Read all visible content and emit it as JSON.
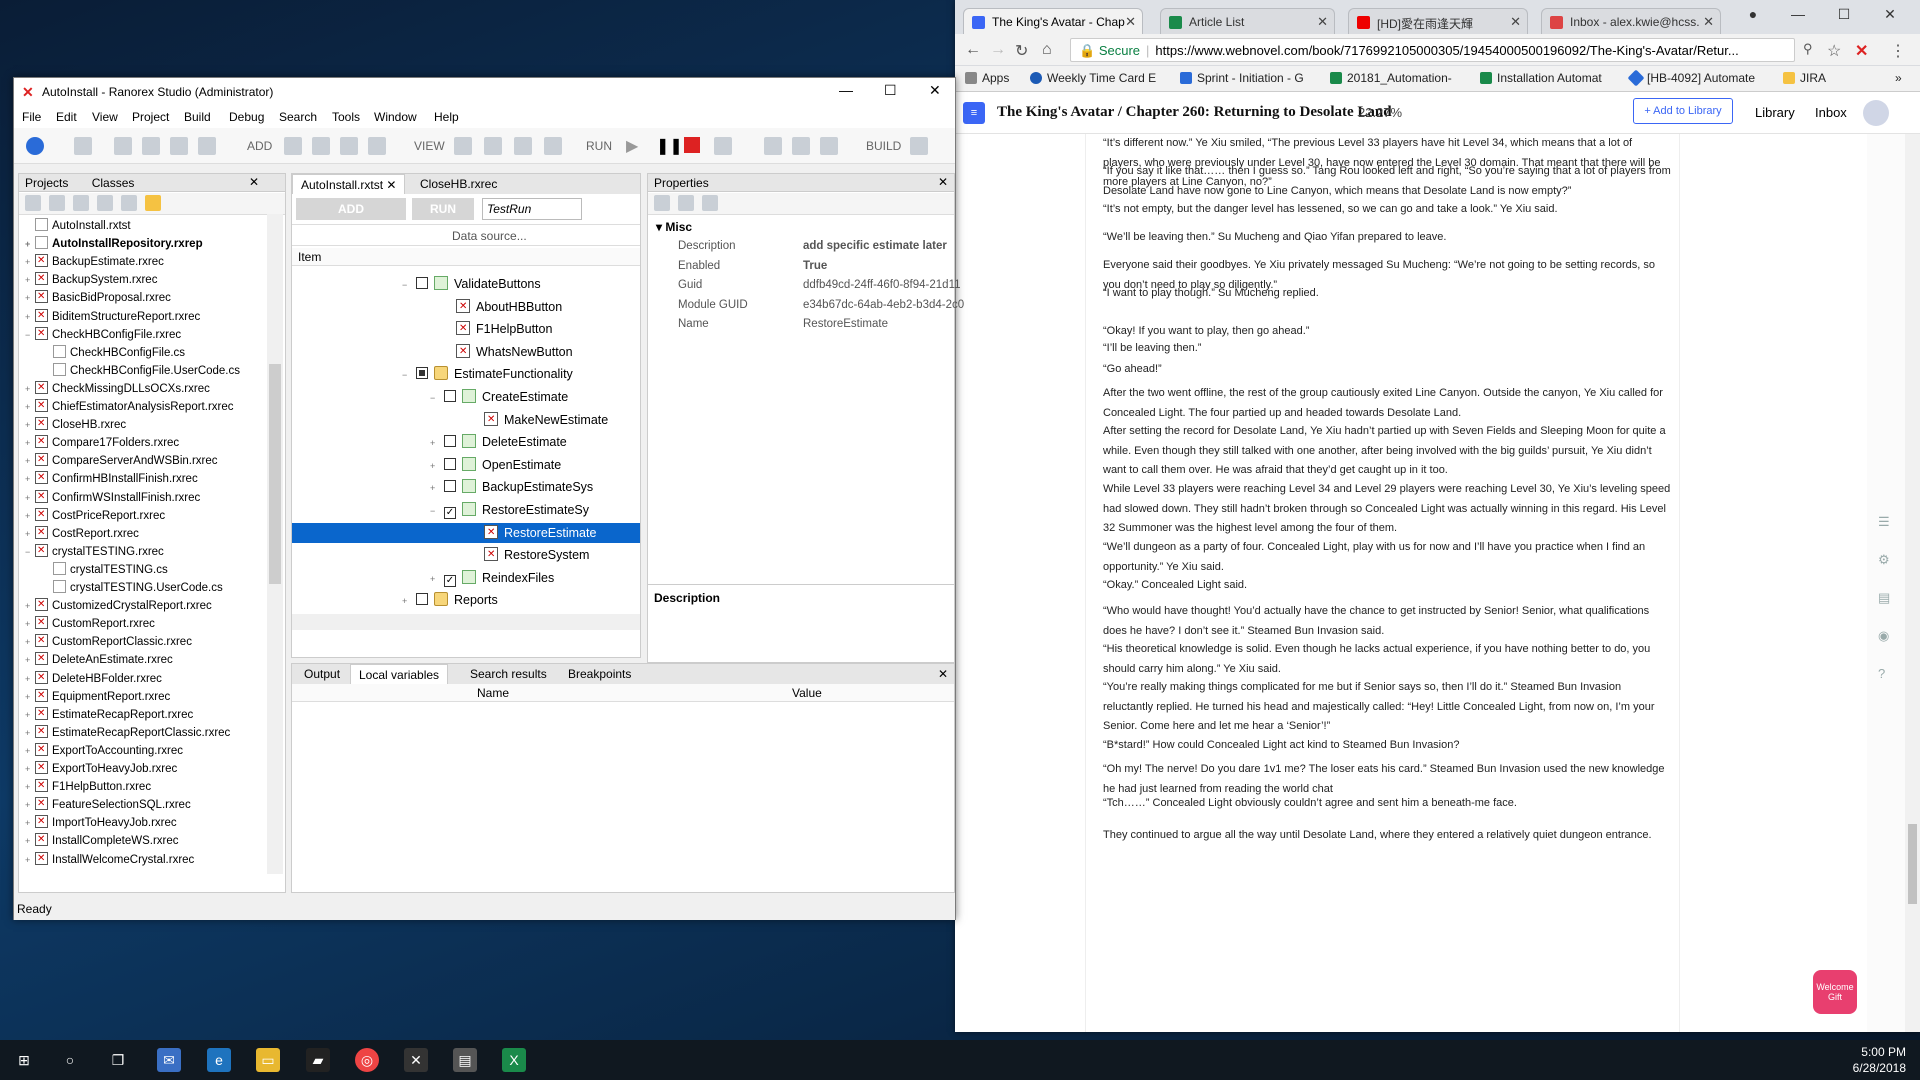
{
  "chrome": {
    "tabs": [
      {
        "label": "The King's Avatar - Chap",
        "color": "#3b66f5",
        "active": true
      },
      {
        "label": "Article List",
        "color": "#1a8a4a"
      },
      {
        "label": "[HD]愛在雨逢天輝",
        "color": "#e00"
      },
      {
        "label": "Inbox - alex.kwie@hcss.",
        "color": "#d44"
      }
    ],
    "secure_label": "Secure",
    "url": "https://www.webnovel.com/book/7176992105000305/19454000500196092/The-King's-Avatar/Retur...",
    "bookmarks": [
      "Apps",
      "Weekly Time Card E",
      "Sprint - Initiation - G",
      "20181_Automation-",
      "Installation Automat",
      "[HB-4092] Automate",
      "JIRA"
    ],
    "book_title": "The King's Avatar / Chapter 260: Returning to Desolate Land",
    "progress": "22.27%",
    "add_to_library": "+ Add to Library",
    "library": "Library",
    "inbox": "Inbox",
    "welcome_gift": "Welcome Gift",
    "paragraphs": [
      "“It’s different now.” Ye Xiu smiled, “The previous Level 33 players have hit Level 34, which means that a lot of players, who were previously under Level 30, have now entered the Level 30 domain. That meant that there will be more players at Line Canyon, no?”",
      "“If you say it like that…… then I guess so.” Tang Rou looked left and right, “So you’re saying that a lot of players from Desolate Land have now gone to Line Canyon, which means that Desolate Land is now empty?”",
      "“It’s not empty, but the danger level has lessened, so we can go and take a look.” Ye Xiu said.",
      "“We’ll be leaving then.” Su Mucheng and Qiao Yifan prepared to leave.",
      "Everyone said their goodbyes. Ye Xiu privately messaged Su Mucheng: “We’re not going to be setting records, so you don’t need to play so diligently.”",
      "“I want to play though.” Su Mucheng replied.",
      "“Okay! If you want to play, then go ahead.”",
      "“I’ll be leaving then.”",
      "“Go ahead!”",
      "After the two went offline, the rest of the group cautiously exited Line Canyon. Outside the canyon, Ye Xiu called for Concealed Light. The four partied up and headed towards Desolate Land.",
      "After setting the record for Desolate Land, Ye Xiu hadn’t partied up with Seven Fields and Sleeping Moon for quite a while. Even though they still talked with one another, after being involved with the big guilds’ pursuit, Ye Xiu didn’t want to call them over. He was afraid that they’d get caught up in it too.",
      "While Level 33 players were reaching Level 34 and Level 29 players were reaching Level 30, Ye Xiu’s leveling speed had slowed down. They still hadn’t broken through so Concealed Light was actually winning in this regard. His Level 32 Summoner was the highest level among the four of them.",
      "“We’ll dungeon as a party of four. Concealed Light, play with us for now and I’ll have you practice when I find an opportunity.” Ye Xiu said.",
      "“Okay.” Concealed Light said.",
      "“Who would have thought! You’d actually have the chance to get instructed by Senior! Senior, what qualifications does he have? I don’t see it.” Steamed Bun Invasion said.",
      "“His theoretical knowledge is solid. Even though he lacks actual experience, if you have nothing better to do, you should carry him along.” Ye Xiu said.",
      "“You’re really making things complicated for me but if Senior says so, then I’ll do it.” Steamed Bun Invasion reluctantly replied. He turned his head and majestically called: “Hey! Little Concealed Light, from now on, I’m your Senior. Come here and let me hear a ‘Senior’!”",
      "“B*stard!” How could Concealed Light act kind to Steamed Bun Invasion?",
      "“Oh my! The nerve! Do you dare 1v1 me? The loser eats his card.” Steamed Bun Invasion used the new knowledge he had just learned from reading the world chat",
      "“Tch……” Concealed Light obviously couldn’t agree and sent him a beneath-me face.",
      "They continued to argue all the way until Desolate Land, where they entered a relatively quiet dungeon entrance."
    ]
  },
  "ranorex": {
    "title": "AutoInstall - Ranorex Studio (Administrator)",
    "menu": [
      "File",
      "Edit",
      "View",
      "Project",
      "Build",
      "Debug",
      "Search",
      "Tools",
      "Window",
      "Help"
    ],
    "toolbar": {
      "add": "ADD",
      "view": "VIEW",
      "run": "RUN",
      "build": "BUILD"
    },
    "projects_tabs": [
      "Projects",
      "Classes"
    ],
    "project_items": [
      {
        "label": "AutoInstall.rxtst",
        "indent": 0,
        "pm": "",
        "icon": "tst"
      },
      {
        "label": "AutoInstallRepository.rxrep",
        "indent": 0,
        "pm": "+",
        "icon": "rep",
        "bold": true
      },
      {
        "label": "BackupEstimate.rxrec",
        "indent": 0,
        "pm": "+",
        "icon": "rx"
      },
      {
        "label": "BackupSystem.rxrec",
        "indent": 0,
        "pm": "+",
        "icon": "rx"
      },
      {
        "label": "BasicBidProposal.rxrec",
        "indent": 0,
        "pm": "+",
        "icon": "rx"
      },
      {
        "label": "BiditemStructureReport.rxrec",
        "indent": 0,
        "pm": "+",
        "icon": "rx"
      },
      {
        "label": "CheckHBConfigFile.rxrec",
        "indent": 0,
        "pm": "−",
        "icon": "rx"
      },
      {
        "label": "CheckHBConfigFile.cs",
        "indent": 1,
        "pm": "",
        "icon": "cs"
      },
      {
        "label": "CheckHBConfigFile.UserCode.cs",
        "indent": 1,
        "pm": "",
        "icon": "cs"
      },
      {
        "label": "CheckMissingDLLsOCXs.rxrec",
        "indent": 0,
        "pm": "+",
        "icon": "rx"
      },
      {
        "label": "ChiefEstimatorAnalysisReport.rxrec",
        "indent": 0,
        "pm": "+",
        "icon": "rx"
      },
      {
        "label": "CloseHB.rxrec",
        "indent": 0,
        "pm": "+",
        "icon": "rx"
      },
      {
        "label": "Compare17Folders.rxrec",
        "indent": 0,
        "pm": "+",
        "icon": "rx"
      },
      {
        "label": "CompareServerAndWSBin.rxrec",
        "indent": 0,
        "pm": "+",
        "icon": "rx"
      },
      {
        "label": "ConfirmHBInstallFinish.rxrec",
        "indent": 0,
        "pm": "+",
        "icon": "rx"
      },
      {
        "label": "ConfirmWSInstallFinish.rxrec",
        "indent": 0,
        "pm": "+",
        "icon": "rx"
      },
      {
        "label": "CostPriceReport.rxrec",
        "indent": 0,
        "pm": "+",
        "icon": "rx"
      },
      {
        "label": "CostReport.rxrec",
        "indent": 0,
        "pm": "+",
        "icon": "rx"
      },
      {
        "label": "crystalTESTING.rxrec",
        "indent": 0,
        "pm": "−",
        "icon": "rx"
      },
      {
        "label": "crystalTESTING.cs",
        "indent": 1,
        "pm": "",
        "icon": "cs"
      },
      {
        "label": "crystalTESTING.UserCode.cs",
        "indent": 1,
        "pm": "",
        "icon": "cs"
      },
      {
        "label": "CustomizedCrystalReport.rxrec",
        "indent": 0,
        "pm": "+",
        "icon": "rx"
      },
      {
        "label": "CustomReport.rxrec",
        "indent": 0,
        "pm": "+",
        "icon": "rx"
      },
      {
        "label": "CustomReportClassic.rxrec",
        "indent": 0,
        "pm": "+",
        "icon": "rx"
      },
      {
        "label": "DeleteAnEstimate.rxrec",
        "indent": 0,
        "pm": "+",
        "icon": "rx"
      },
      {
        "label": "DeleteHBFolder.rxrec",
        "indent": 0,
        "pm": "+",
        "icon": "rx"
      },
      {
        "label": "EquipmentReport.rxrec",
        "indent": 0,
        "pm": "+",
        "icon": "rx"
      },
      {
        "label": "EstimateRecapReport.rxrec",
        "indent": 0,
        "pm": "+",
        "icon": "rx"
      },
      {
        "label": "EstimateRecapReportClassic.rxrec",
        "indent": 0,
        "pm": "+",
        "icon": "rx"
      },
      {
        "label": "ExportToAccounting.rxrec",
        "indent": 0,
        "pm": "+",
        "icon": "rx"
      },
      {
        "label": "ExportToHeavyJob.rxrec",
        "indent": 0,
        "pm": "+",
        "icon": "rx"
      },
      {
        "label": "F1HelpButton.rxrec",
        "indent": 0,
        "pm": "+",
        "icon": "rx"
      },
      {
        "label": "FeatureSelectionSQL.rxrec",
        "indent": 0,
        "pm": "+",
        "icon": "rx"
      },
      {
        "label": "ImportToHeavyJob.rxrec",
        "indent": 0,
        "pm": "+",
        "icon": "rx"
      },
      {
        "label": "InstallCompleteWS.rxrec",
        "indent": 0,
        "pm": "+",
        "icon": "rx"
      },
      {
        "label": "InstallWelcomeCrystal.rxrec",
        "indent": 0,
        "pm": "+",
        "icon": "rx"
      }
    ],
    "editor_tabs": [
      "AutoInstall.rxtst",
      "CloseHB.rxrec"
    ],
    "editor_add": "ADD",
    "editor_run": "RUN",
    "testrun": "TestRun",
    "data_source": "Data source...",
    "item_header": "Item",
    "tree": [
      {
        "label": "ValidateButtons",
        "level": 1,
        "exp": "−",
        "cb": "",
        "icon": "tc"
      },
      {
        "label": "AboutHBButton",
        "level": 2,
        "exp": "",
        "cb": null,
        "icon": "rec"
      },
      {
        "label": "F1HelpButton",
        "level": 2,
        "exp": "",
        "cb": null,
        "icon": "rec"
      },
      {
        "label": "WhatsNewButton",
        "level": 2,
        "exp": "",
        "cb": null,
        "icon": "rec"
      },
      {
        "label": "EstimateFunctionality",
        "level": 1,
        "exp": "−",
        "cb": "part",
        "icon": "fo"
      },
      {
        "label": "CreateEstimate",
        "level": 2,
        "exp": "−",
        "cb": "",
        "icon": "tc"
      },
      {
        "label": "MakeNewEstimate",
        "level": 3,
        "exp": "",
        "cb": null,
        "icon": "rec"
      },
      {
        "label": "DeleteEstimate",
        "level": 2,
        "exp": "+",
        "cb": "",
        "icon": "tc"
      },
      {
        "label": "OpenEstimate",
        "level": 2,
        "exp": "+",
        "cb": "",
        "icon": "tc"
      },
      {
        "label": "BackupEstimateSys",
        "level": 2,
        "exp": "+",
        "cb": "",
        "icon": "tc"
      },
      {
        "label": "RestoreEstimateSy",
        "level": 2,
        "exp": "−",
        "cb": "check",
        "icon": "tc"
      },
      {
        "label": "RestoreEstimate",
        "level": 3,
        "exp": "",
        "cb": null,
        "icon": "rec",
        "selected": true
      },
      {
        "label": "RestoreSystem",
        "level": 3,
        "exp": "",
        "cb": null,
        "icon": "rec"
      },
      {
        "label": "ReindexFiles",
        "level": 2,
        "exp": "+",
        "cb": "check",
        "icon": "tc"
      },
      {
        "label": "Reports",
        "level": 1,
        "exp": "+",
        "cb": "",
        "icon": "fo"
      }
    ],
    "properties": {
      "title": "Properties",
      "section": "Misc",
      "rows": [
        {
          "k": "Description",
          "v": "add specific estimate later"
        },
        {
          "k": "Enabled",
          "v": "True"
        },
        {
          "k": "Guid",
          "v": "ddfb49cd-24ff-46f0-8f94-21d11"
        },
        {
          "k": "Module GUID",
          "v": "e34b67dc-64ab-4eb2-b3d4-2c0"
        },
        {
          "k": "Name",
          "v": "RestoreEstimate"
        }
      ],
      "desc_label": "Description"
    },
    "bottom_tabs": [
      "Output",
      "Local variables",
      "Search results",
      "Breakpoints"
    ],
    "bottom_cols": [
      "Name",
      "Value"
    ],
    "status": "Ready"
  },
  "taskbar": {
    "time": "5:00 PM",
    "date": "6/28/2018"
  }
}
